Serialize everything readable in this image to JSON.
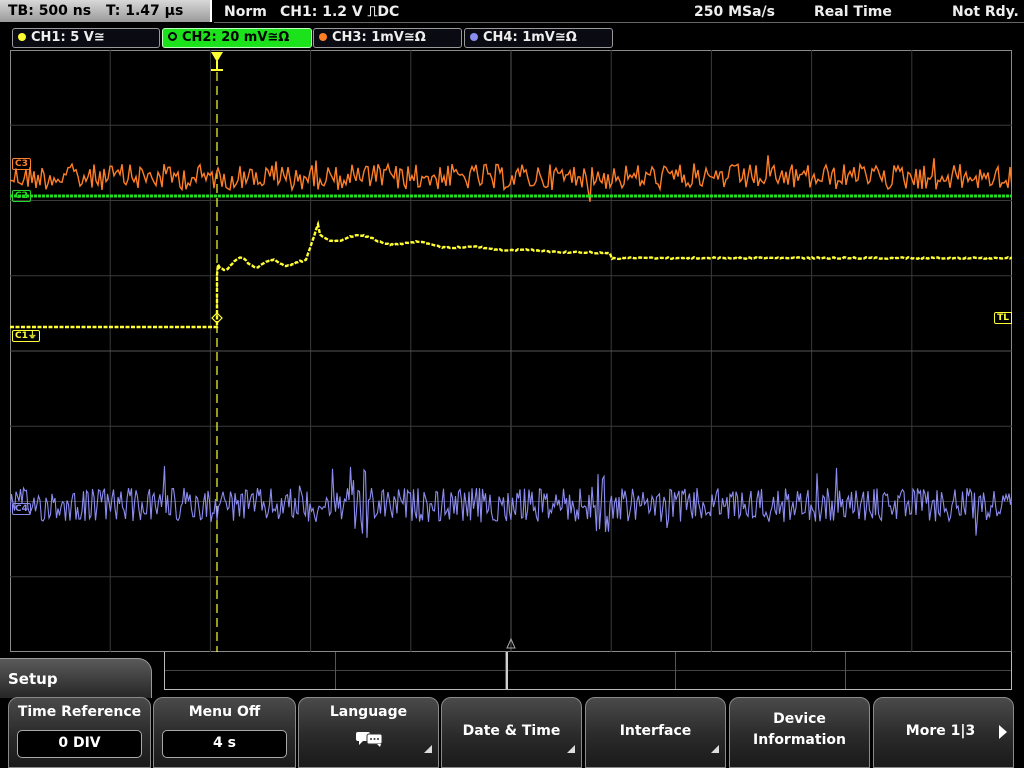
{
  "status": {
    "timebase": "TB: 500 ns",
    "trigger_time": "T: 1.47 µs",
    "mode": "Norm",
    "trigger": "CH1: 1.2 V ⎍DC",
    "sample_rate": "250 MSa/s",
    "acq_mode": "Real Time",
    "state": "Not Rdy."
  },
  "channels": [
    {
      "label": "CH1: 5 V≅",
      "color": "#ffff33"
    },
    {
      "label": "CH2: 20 mV≅Ω",
      "color": "#22dd22",
      "active": true
    },
    {
      "label": "CH3: 1mV≅Ω",
      "color": "#ff7f27"
    },
    {
      "label": "CH4: 1mV≅Ω",
      "color": "#8c8cf0"
    }
  ],
  "markers": {
    "c1": "C1⏚",
    "c2": "C2",
    "c3": "C3",
    "c4": "C4",
    "trigger_level": "TL"
  },
  "menu": {
    "title": "Setup",
    "keys": [
      {
        "label": "Time Reference",
        "value": "0 DIV"
      },
      {
        "label": "Menu Off",
        "value": "4 s"
      },
      {
        "label": "Language",
        "icon": "speech-bubble-icon"
      },
      {
        "label": "Date & Time"
      },
      {
        "label": "Interface"
      },
      {
        "label": "Device",
        "label2": "Information"
      },
      {
        "label": "More 1|3"
      }
    ]
  },
  "colors": {
    "ch1": "#ffff33",
    "ch2": "#22dd22",
    "ch3": "#ff7f27",
    "ch4": "#8c8cf0",
    "grid": "#3a3a3a"
  }
}
